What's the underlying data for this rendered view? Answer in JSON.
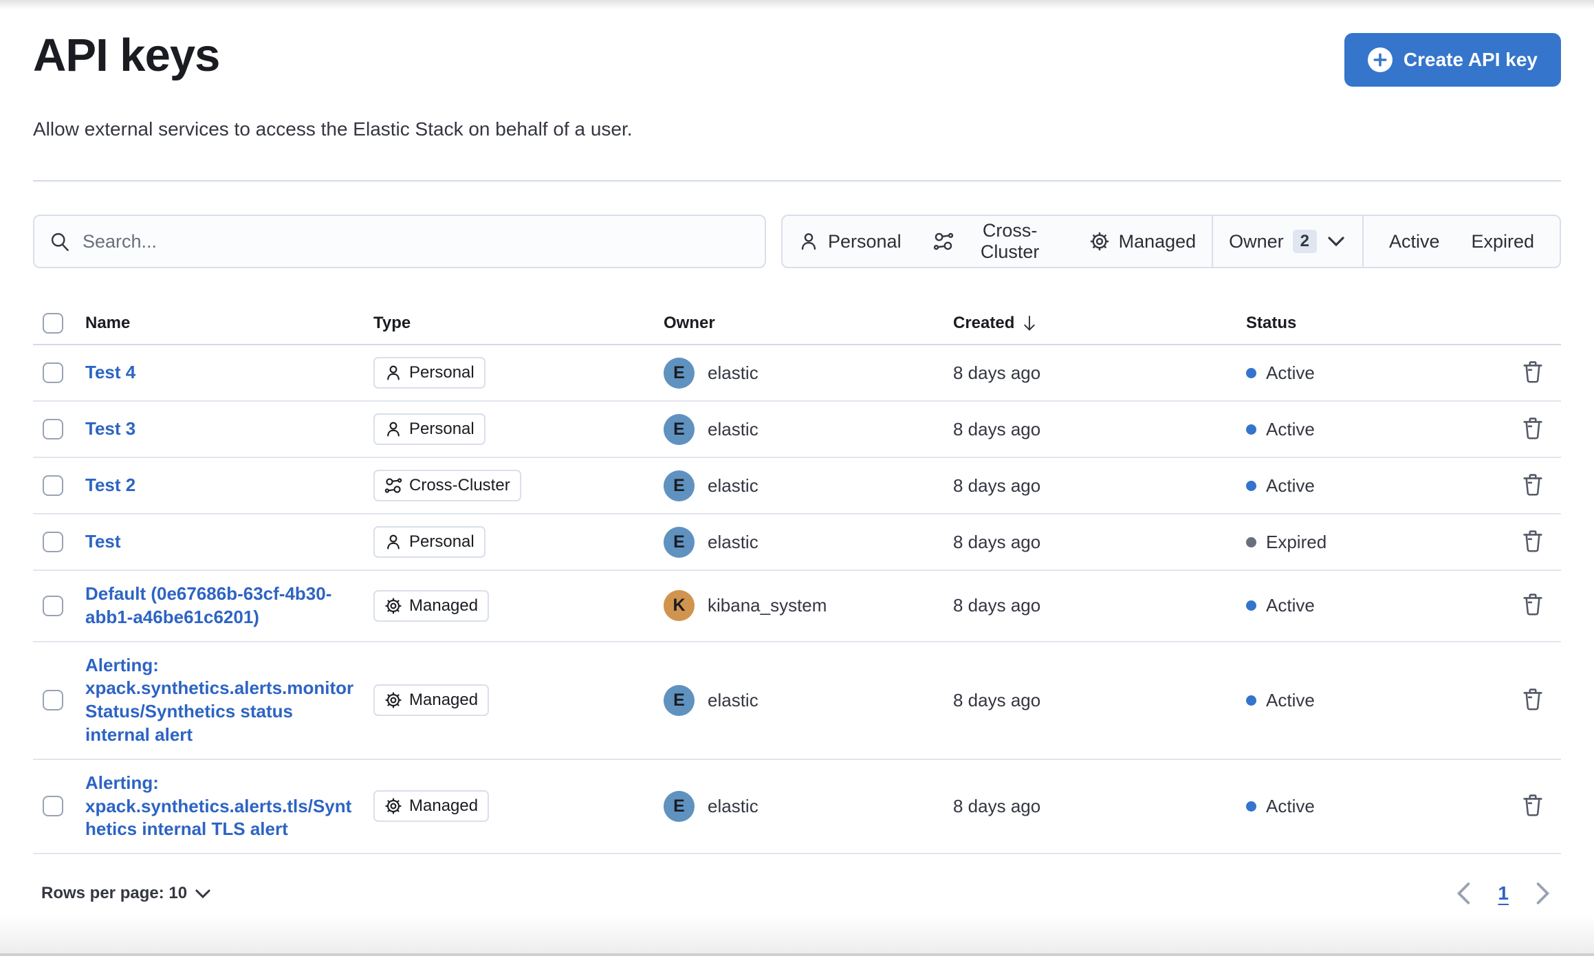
{
  "page": {
    "title": "API keys",
    "subtitle": "Allow external services to access the Elastic Stack on behalf of a user."
  },
  "header": {
    "create_button": "Create API key"
  },
  "search": {
    "placeholder": "Search..."
  },
  "filters": {
    "personal": "Personal",
    "cross_cluster": "Cross-Cluster",
    "managed": "Managed",
    "owner": "Owner",
    "owner_count": "2",
    "active": "Active",
    "expired": "Expired"
  },
  "table": {
    "columns": {
      "name": "Name",
      "type": "Type",
      "owner": "Owner",
      "created": "Created",
      "status": "Status"
    },
    "rows": [
      {
        "name": "Test 4",
        "type_label": "Personal",
        "type_icon": "user-icon",
        "owner": "elastic",
        "owner_initial": "E",
        "avatar_color": "#6092C0",
        "created": "8 days ago",
        "status": "Active",
        "status_color": "#3574CE"
      },
      {
        "name": "Test 3",
        "type_label": "Personal",
        "type_icon": "user-icon",
        "owner": "elastic",
        "owner_initial": "E",
        "avatar_color": "#6092C0",
        "created": "8 days ago",
        "status": "Active",
        "status_color": "#3574CE"
      },
      {
        "name": "Test 2",
        "type_label": "Cross-Cluster",
        "type_icon": "cluster-icon",
        "owner": "elastic",
        "owner_initial": "E",
        "avatar_color": "#6092C0",
        "created": "8 days ago",
        "status": "Active",
        "status_color": "#3574CE"
      },
      {
        "name": "Test",
        "type_label": "Personal",
        "type_icon": "user-icon",
        "owner": "elastic",
        "owner_initial": "E",
        "avatar_color": "#6092C0",
        "created": "8 days ago",
        "status": "Expired",
        "status_color": "#69707D"
      },
      {
        "name": "Default (0e67686b-63cf-4b30-abb1-a46be61c6201)",
        "type_label": "Managed",
        "type_icon": "gear-icon",
        "owner": "kibana_system",
        "owner_initial": "K",
        "avatar_color": "#D0944E",
        "created": "8 days ago",
        "status": "Active",
        "status_color": "#3574CE"
      },
      {
        "name": "Alerting: xpack.synthetics.alerts.monitorStatus/Synthetics status internal alert",
        "type_label": "Managed",
        "type_icon": "gear-icon",
        "owner": "elastic",
        "owner_initial": "E",
        "avatar_color": "#6092C0",
        "created": "8 days ago",
        "status": "Active",
        "status_color": "#3574CE"
      },
      {
        "name": "Alerting: xpack.synthetics.alerts.tls/Synthetics internal TLS alert",
        "type_label": "Managed",
        "type_icon": "gear-icon",
        "owner": "elastic",
        "owner_initial": "E",
        "avatar_color": "#6092C0",
        "created": "8 days ago",
        "status": "Active",
        "status_color": "#3574CE"
      }
    ]
  },
  "pagination": {
    "rows_per_page": "Rows per page: 10",
    "page": "1"
  },
  "colors": {
    "primary_button": "#3575CC",
    "link": "#2D64C4",
    "active_dot": "#3574CE",
    "expired_dot": "#69707D",
    "avatar_elastic": "#6092C0",
    "avatar_kibana_system": "#D0944E"
  }
}
